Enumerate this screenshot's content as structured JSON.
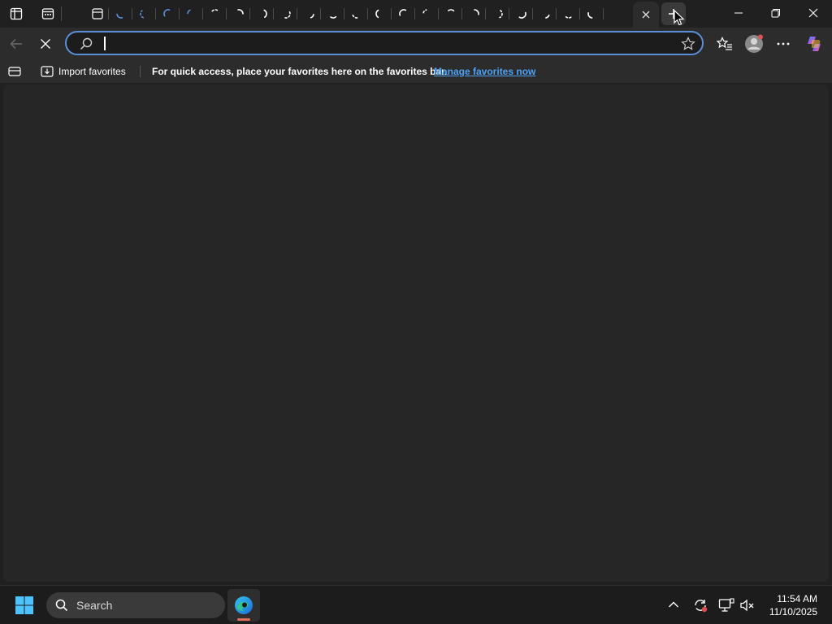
{
  "browser": {
    "tabs_count": 23,
    "active_tab": {
      "close_icon": "close-icon"
    },
    "new_tab_icon": "plus-icon",
    "window_controls": [
      "minimize-icon",
      "restore-icon",
      "close-icon"
    ]
  },
  "toolbar": {
    "address": {
      "value": "",
      "placeholder": ""
    }
  },
  "favorites_bar": {
    "import_label": "Import favorites",
    "message": "For quick access, place your favorites here on the favorites bar.",
    "manage_link": "Manage favorites now"
  },
  "taskbar": {
    "search_label": "Search",
    "time": "11:54 AM",
    "date": "11/10/2025"
  },
  "colors": {
    "accent": "#4ea1f3",
    "address_border": "#5a8fd8",
    "page_bg": "#262626"
  }
}
